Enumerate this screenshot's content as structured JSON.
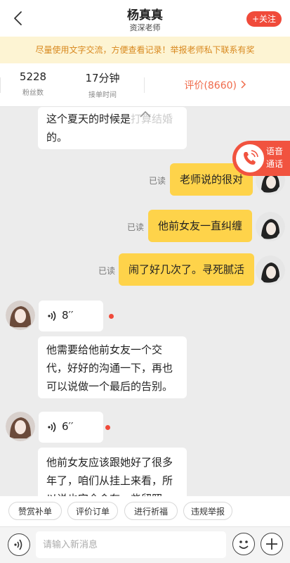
{
  "header": {
    "title": "杨真真",
    "subtitle": "资深老师",
    "follow_label": "+关注"
  },
  "notice": "尽量使用文字交流，方便查看记录！举报老师私下联系有奖",
  "stats": {
    "fans_value": "5228",
    "fans_label": "粉丝数",
    "time_value": "17分钟",
    "time_label": "接单时间",
    "rating_label": "评价(8660)"
  },
  "messages": [
    {
      "side": "left",
      "type": "text",
      "text_line1": "这个夏天的时候是",
      "text_line1_hidden": "打算结婚",
      "text_line2": "的。"
    },
    {
      "side": "right",
      "type": "text",
      "text": "老师说的很对",
      "read": "已读"
    },
    {
      "side": "right",
      "type": "text",
      "text": "他前女友一直纠缠",
      "read": "已读"
    },
    {
      "side": "right",
      "type": "text",
      "text": "闹了好几次了。寻死腻活",
      "read": "已读"
    },
    {
      "side": "left",
      "type": "voice",
      "duration": "8′′"
    },
    {
      "side": "left",
      "type": "text",
      "lines": [
        "他需要给他前女友一个交",
        "代，好好的沟通一下，再也",
        "可以说做一个最后的告别。"
      ]
    },
    {
      "side": "left",
      "type": "voice",
      "duration": "6′′"
    },
    {
      "side": "left",
      "type": "text",
      "lines": [
        "他前女友应该跟她好了很多",
        "年了，咱们从挂上来看，所",
        "以说也完全会有一些留照"
      ]
    }
  ],
  "call_float": {
    "line1": "语音",
    "line2": "通话"
  },
  "quick_actions": [
    "赞赏补单",
    "评价订单",
    "进行祈福",
    "违规举报"
  ],
  "input": {
    "placeholder": "请输入新消息"
  },
  "colors": {
    "accent": "#f04a3a",
    "bubble_self": "#fed34a",
    "notice_text": "#d8881e",
    "notice_bg": "#fdf4d3"
  }
}
